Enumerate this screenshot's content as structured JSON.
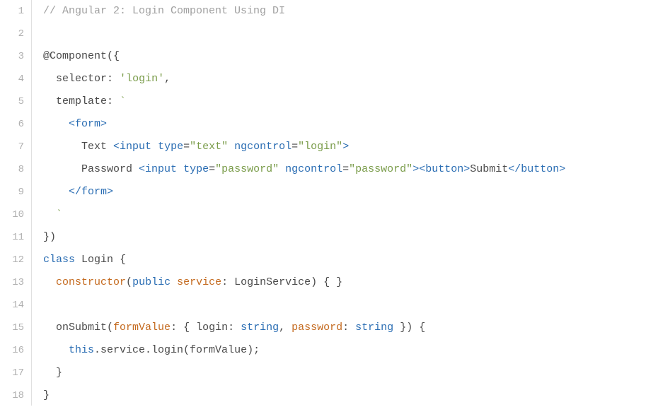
{
  "gutter": {
    "l1": "1",
    "l2": "2",
    "l3": "3",
    "l4": "4",
    "l5": "5",
    "l6": "6",
    "l7": "7",
    "l8": "8",
    "l9": "9",
    "l10": "10",
    "l11": "11",
    "l12": "12",
    "l13": "13",
    "l14": "14",
    "l15": "15",
    "l16": "16",
    "l17": "17",
    "l18": "18"
  },
  "code": {
    "l1": {
      "comment": "// Angular 2: Login Component Using DI"
    },
    "l3": {
      "p1": "@Component",
      "p2": "({"
    },
    "l4": {
      "indent": "  ",
      "key": "selector",
      "colon": ": ",
      "q1": "'",
      "val": "login",
      "q2": "'",
      "comma": ","
    },
    "l5": {
      "indent": "  ",
      "key": "template",
      "colon": ": ",
      "tick": "`"
    },
    "l6": {
      "indent": "    ",
      "open": "<",
      "tag": "form",
      "close": ">"
    },
    "l7": {
      "indent": "      ",
      "text1": "Text ",
      "o1": "<",
      "tag1": "input",
      "sp1": " ",
      "a1": "type",
      "eq1": "=",
      "v1": "\"text\"",
      "sp2": " ",
      "a2": "ngcontrol",
      "eq2": "=",
      "v2": "\"login\"",
      "c1": ">"
    },
    "l8": {
      "indent": "      ",
      "text1": "Password ",
      "o1": "<",
      "tag1": "input",
      "sp1": " ",
      "a1": "type",
      "eq1": "=",
      "v1": "\"password\"",
      "sp2": " ",
      "a2": "ngcontrol",
      "eq2": "=",
      "v2": "\"password\"",
      "c1": ">",
      "o2": "<",
      "tag2": "button",
      "c2": ">",
      "text2": "Submit",
      "o3": "</",
      "tag3": "button",
      "c3": ">"
    },
    "l9": {
      "indent": "    ",
      "open": "</",
      "tag": "form",
      "close": ">"
    },
    "l10": {
      "indent": "  ",
      "tick": "`"
    },
    "l11": {
      "p1": "})"
    },
    "l12": {
      "kw": "class",
      "sp": " ",
      "name": "Login",
      "sp2": " ",
      "brace": "{"
    },
    "l13": {
      "indent": "  ",
      "ctor": "constructor",
      "p1": "(",
      "kw": "public",
      "sp": " ",
      "param": "service",
      "colon": ": ",
      "type": "LoginService",
      "p2": ") { }"
    },
    "l15": {
      "indent": "  ",
      "fn": "onSubmit",
      "p1": "(",
      "param": "formValue",
      "colon": ": { ",
      "k1": "login",
      "c1": ": ",
      "t1": "string",
      "comma": ", ",
      "k2": "password",
      "c2": ": ",
      "t2": "string",
      "p2": " }) {"
    },
    "l16": {
      "indent": "    ",
      "this": "this",
      "rest": ".service.login(formValue);"
    },
    "l17": {
      "indent": "  ",
      "brace": "}"
    },
    "l18": {
      "brace": "}"
    }
  }
}
